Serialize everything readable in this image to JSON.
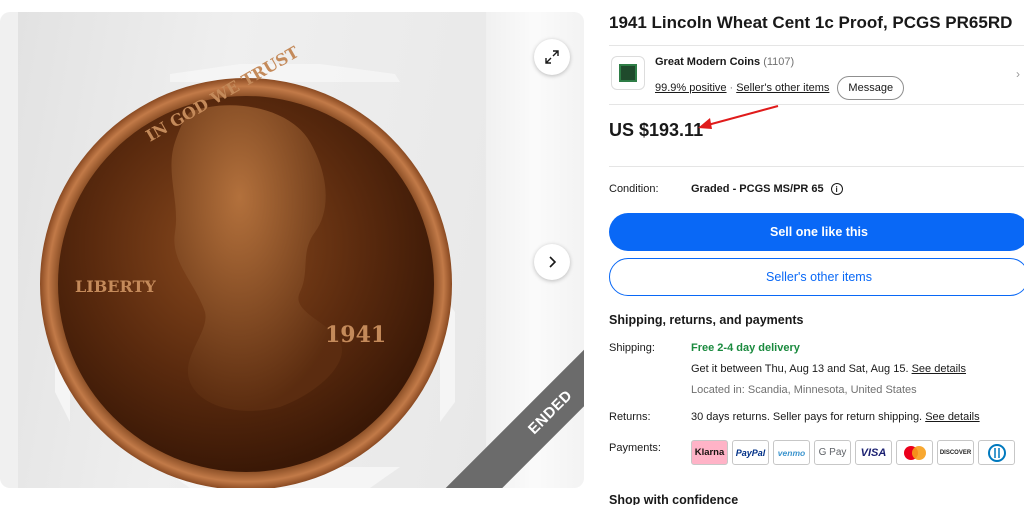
{
  "gallery": {
    "ended_label": "ENDED",
    "coin_text_top": "IN GOD WE TRUST",
    "coin_text_left": "LIBERTY",
    "coin_year": "1941"
  },
  "listing": {
    "title": "1941 Lincoln Wheat Cent 1c Proof, PCGS PR65RD",
    "price": "US $193.11"
  },
  "seller": {
    "name": "Great Modern Coins",
    "count": "(1107)",
    "positive": "99.9% positive",
    "separator": "·",
    "other_items": "Seller's other items",
    "message_btn": "Message"
  },
  "condition": {
    "label": "Condition:",
    "value": "Graded - PCGS MS/PR 65"
  },
  "buttons": {
    "sell": "Sell one like this",
    "other_items": "Seller's other items"
  },
  "shipping_section": {
    "heading": "Shipping, returns, and payments",
    "shipping_label": "Shipping:",
    "free": "Free 2-4 day delivery",
    "eta": "Get it between Thu, Aug 13 and Sat, Aug 15.",
    "see_details": "See details",
    "location": "Located in: Scandia, Minnesota, United States",
    "returns_label": "Returns:",
    "returns_text": "30 days returns. Seller pays for return shipping.",
    "returns_details": "See details",
    "payments_label": "Payments:",
    "payment_methods": [
      "Klarna",
      "PayPal",
      "venmo",
      "G Pay",
      "VISA",
      "Mastercard",
      "DISCOVER",
      "Diners Club"
    ]
  },
  "shop": {
    "heading": "Shop with confidence"
  },
  "colors": {
    "accent": "#0968f6",
    "free_delivery": "#1a8a3e",
    "ended_band": "#6b6b6b",
    "annotation_arrow": "#e01b1b"
  }
}
